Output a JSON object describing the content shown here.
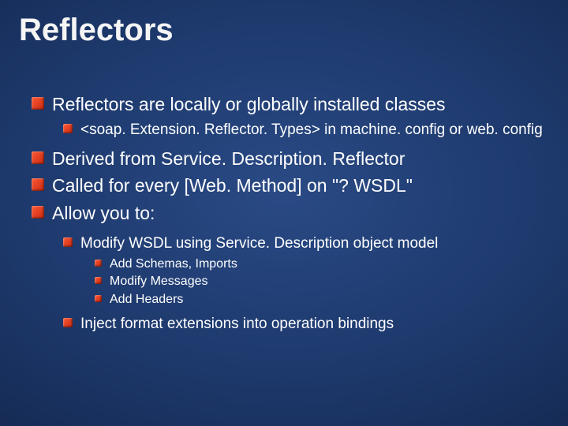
{
  "title": "Reflectors",
  "items": [
    {
      "lv": 0,
      "t": "Reflectors are locally or globally installed classes"
    },
    {
      "lv": 1,
      "t": "<soap. Extension. Reflector. Types> in machine. config or web. config"
    },
    {
      "lv": 0,
      "t": "Derived from Service. Description. Reflector"
    },
    {
      "lv": 0,
      "t": "Called for every [Web. Method] on \"? WSDL\""
    },
    {
      "lv": 0,
      "t": "Allow you to:"
    },
    {
      "lv": 1,
      "t": "Modify WSDL using Service. Description object model"
    },
    {
      "lv": 2,
      "t": "Add Schemas, Imports"
    },
    {
      "lv": 2,
      "t": "Modify Messages"
    },
    {
      "lv": 2,
      "t": "Add Headers"
    },
    {
      "lv": 1,
      "t": "Inject format extensions into operation bindings"
    }
  ]
}
